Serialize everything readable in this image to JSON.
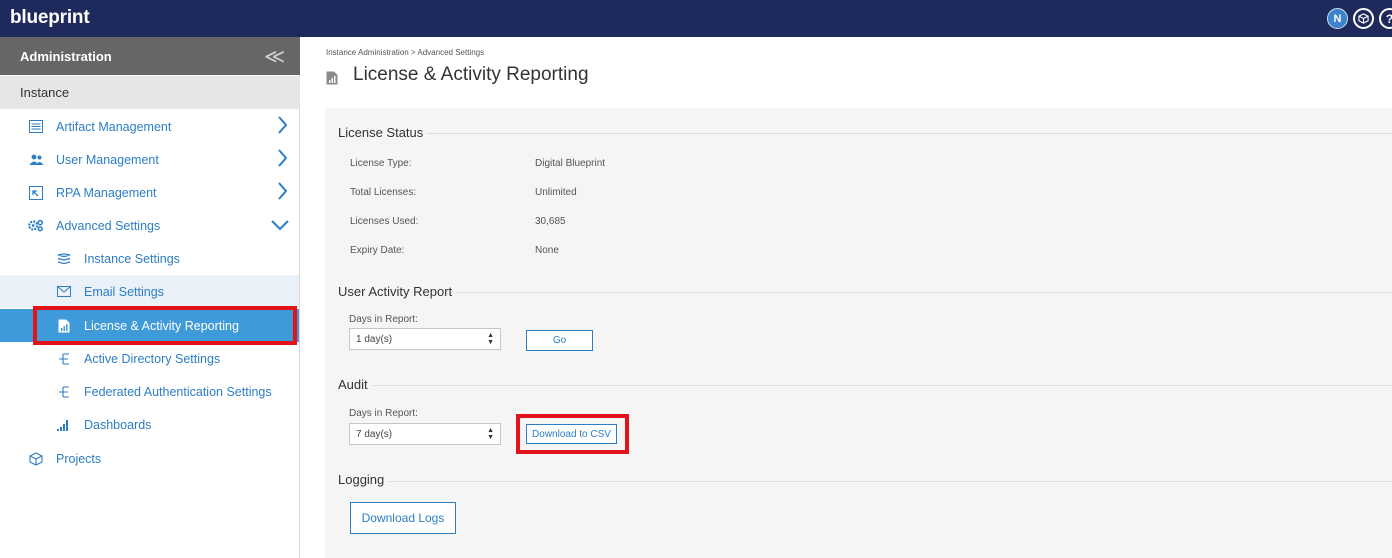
{
  "app": {
    "logo": "blueprint"
  },
  "topbar": {
    "user_initial": "N",
    "help_glyph": "?"
  },
  "sidebar": {
    "header": "Administration",
    "section": "Instance",
    "items": [
      {
        "label": "Artifact Management",
        "icon": "artifact-management-icon",
        "expand": "chevron-right"
      },
      {
        "label": "User Management",
        "icon": "users-icon",
        "expand": "chevron-right"
      },
      {
        "label": "RPA Management",
        "icon": "rpa-icon",
        "expand": "chevron-right"
      },
      {
        "label": "Advanced Settings",
        "icon": "gears-icon",
        "expand": "chevron-down"
      }
    ],
    "subitems": [
      {
        "label": "Instance Settings",
        "icon": "layers-icon"
      },
      {
        "label": "Email Settings",
        "icon": "envelope-icon"
      },
      {
        "label": "License & Activity Reporting",
        "icon": "report-icon",
        "active": true
      },
      {
        "label": "Active Directory Settings",
        "icon": "directory-icon"
      },
      {
        "label": "Federated Authentication Settings",
        "icon": "directory-icon"
      },
      {
        "label": "Dashboards",
        "icon": "bar-chart-icon"
      }
    ],
    "projects": {
      "label": "Projects",
      "icon": "cube-icon"
    }
  },
  "main": {
    "breadcrumb": "Instance Administration > Advanced Settings",
    "title": "License & Activity Reporting",
    "license_status": {
      "legend": "License Status",
      "rows": [
        {
          "label": "License Type:",
          "value": "Digital Blueprint"
        },
        {
          "label": "Total Licenses:",
          "value": "Unlimited"
        },
        {
          "label": "Licenses Used:",
          "value": "30,685"
        },
        {
          "label": "Expiry Date:",
          "value": "None"
        }
      ]
    },
    "user_activity": {
      "legend": "User Activity Report",
      "field_label": "Days in Report:",
      "selected": "1 day(s)",
      "button": "Go"
    },
    "audit": {
      "legend": "Audit",
      "field_label": "Days in Report:",
      "selected": "7 day(s)",
      "button": "Download to CSV"
    },
    "logging": {
      "legend": "Logging",
      "button": "Download Logs"
    }
  },
  "colors": {
    "topbar": "#1f2a5c",
    "accent": "#2d7ec4",
    "active_item": "#3e9ad8",
    "highlight": "#e3131b"
  }
}
